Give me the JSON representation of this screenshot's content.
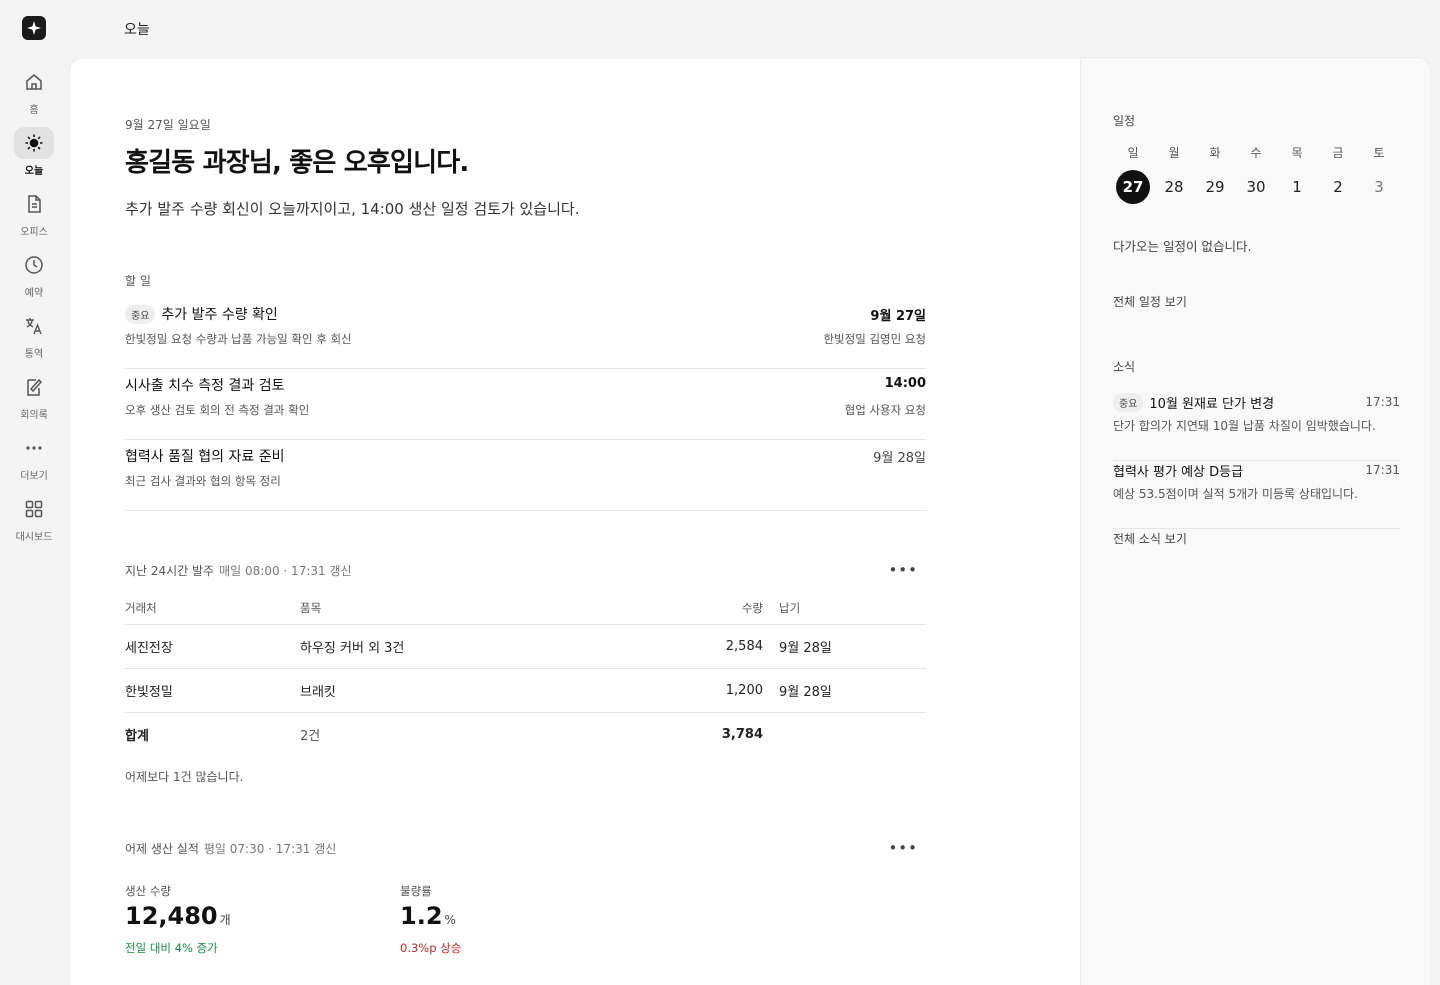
{
  "nav": {
    "items": [
      {
        "label": "홈",
        "icon": "home-icon"
      },
      {
        "label": "오늘",
        "icon": "sun-icon",
        "active": true
      },
      {
        "label": "오피스",
        "icon": "document-icon"
      },
      {
        "label": "예약",
        "icon": "clock-icon"
      },
      {
        "label": "통역",
        "icon": "translate-icon"
      },
      {
        "label": "회의록",
        "icon": "note-edit-icon"
      },
      {
        "label": "더보기",
        "icon": "more-dots-icon"
      },
      {
        "label": "대시보드",
        "icon": "dashboard-grid-icon"
      }
    ]
  },
  "topbar": {
    "title": "오늘"
  },
  "header": {
    "date": "9월 27일 일요일",
    "greeting": "홍길동 과장님, 좋은 오후입니다.",
    "summary": "추가 발주 수량 회신이 오늘까지이고, 14:00 생산 일정 검토가 있습니다."
  },
  "todo": {
    "title": "할 일",
    "items": [
      {
        "badge": "중요",
        "title": "추가 발주 수량 확인",
        "desc": "한빛정밀 요청 수량과 납품 가능일 확인 후 회신",
        "due": "9월 27일",
        "requester": "한빛정밀 김영민 요청"
      },
      {
        "title": "시사출 치수 측정 결과 검토",
        "desc": "오후 생산 검토 회의 전 측정 결과 확인",
        "due": "14:00",
        "requester": "협업 사용자 요청"
      },
      {
        "title": "협력사 품질 협의 자료 준비",
        "desc": "최근 검사 결과와 협의 항목 정리",
        "due": "9월 28일"
      }
    ]
  },
  "orders": {
    "title": "지난 24시간 발주",
    "schedule": "매일 08:00 · 17:31 갱신",
    "columns": {
      "vendor": "거래처",
      "item": "품목",
      "qty": "수량",
      "due": "납기"
    },
    "rows": [
      {
        "vendor": "세진전장",
        "item": "하우징 커버 외 3건",
        "qty": "2,584",
        "due": "9월 28일"
      },
      {
        "vendor": "한빛정밀",
        "item": "브래킷",
        "qty": "1,200",
        "due": "9월 28일"
      }
    ],
    "total": {
      "label": "합계",
      "count": "2건",
      "qty": "3,784"
    },
    "note": "어제보다 1건 많습니다."
  },
  "production": {
    "title": "어제 생산 실적",
    "schedule": "평일 07:30 · 17:31 갱신",
    "qty": {
      "label": "생산 수량",
      "value": "12,480",
      "unit": "개",
      "delta": "전일 대비 4% 증가"
    },
    "defect": {
      "label": "불량률",
      "value": "1.2",
      "unit": "%",
      "delta": "0.3%p 상승"
    }
  },
  "schedule": {
    "title": "일정",
    "weekdays": [
      "일",
      "월",
      "화",
      "수",
      "목",
      "금",
      "토"
    ],
    "days": [
      "27",
      "28",
      "29",
      "30",
      "1",
      "2",
      "3"
    ],
    "empty": "다가오는 일정이 없습니다.",
    "link": "전체 일정 보기"
  },
  "news": {
    "title": "소식",
    "items": [
      {
        "badge": "중요",
        "title": "10월 원재료 단가 변경",
        "time": "17:31",
        "desc": "단가 합의가 지연돼 10월 납품 차질이 임박했습니다."
      },
      {
        "title": "협력사 평가 예상 D등급",
        "time": "17:31",
        "desc": "예상 53.5점이며 실적 5개가 미등록 상태입니다."
      }
    ],
    "link": "전체 소식 보기"
  },
  "colors": {
    "accent_up": "#1e8a4a",
    "accent_down": "#c62828",
    "selected_day": "#111111"
  }
}
